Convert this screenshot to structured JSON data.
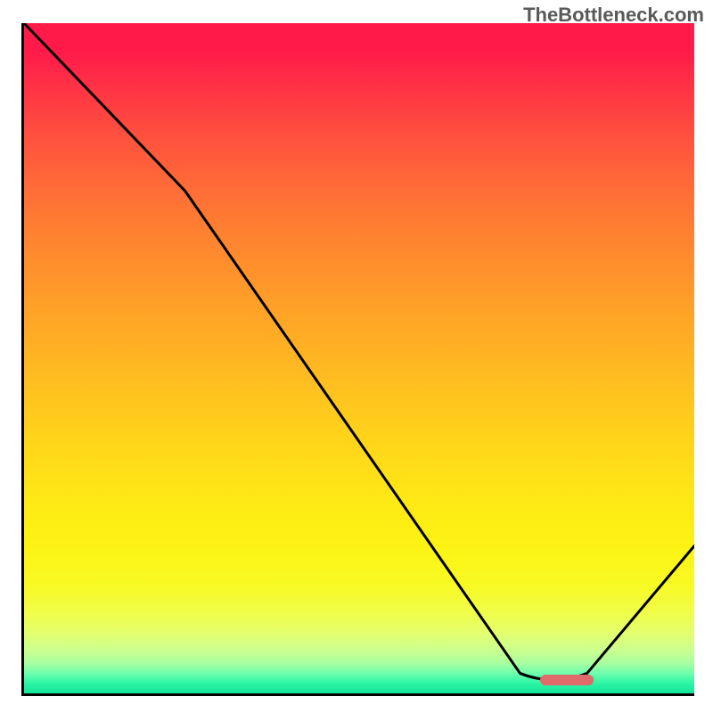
{
  "watermark": "TheBottleneck.com",
  "chart_data": {
    "type": "line",
    "title": "",
    "xlabel": "",
    "ylabel": "",
    "xlim": [
      0,
      100
    ],
    "ylim": [
      0,
      100
    ],
    "grid": false,
    "legend": false,
    "curve_points": [
      {
        "x": 0,
        "y": 100
      },
      {
        "x": 24,
        "y": 75
      },
      {
        "x": 74,
        "y": 3
      },
      {
        "x": 79,
        "y": 2
      },
      {
        "x": 84,
        "y": 3
      },
      {
        "x": 100,
        "y": 22
      }
    ],
    "marker": {
      "x_start": 77,
      "x_end": 85,
      "y": 2,
      "color": "#e06a6a"
    },
    "gradient_stops": [
      {
        "pos": 0,
        "color": "#ff1a4a"
      },
      {
        "pos": 50,
        "color": "#ffba21"
      },
      {
        "pos": 85,
        "color": "#f8fa25"
      },
      {
        "pos": 100,
        "color": "#14e49a"
      }
    ]
  }
}
